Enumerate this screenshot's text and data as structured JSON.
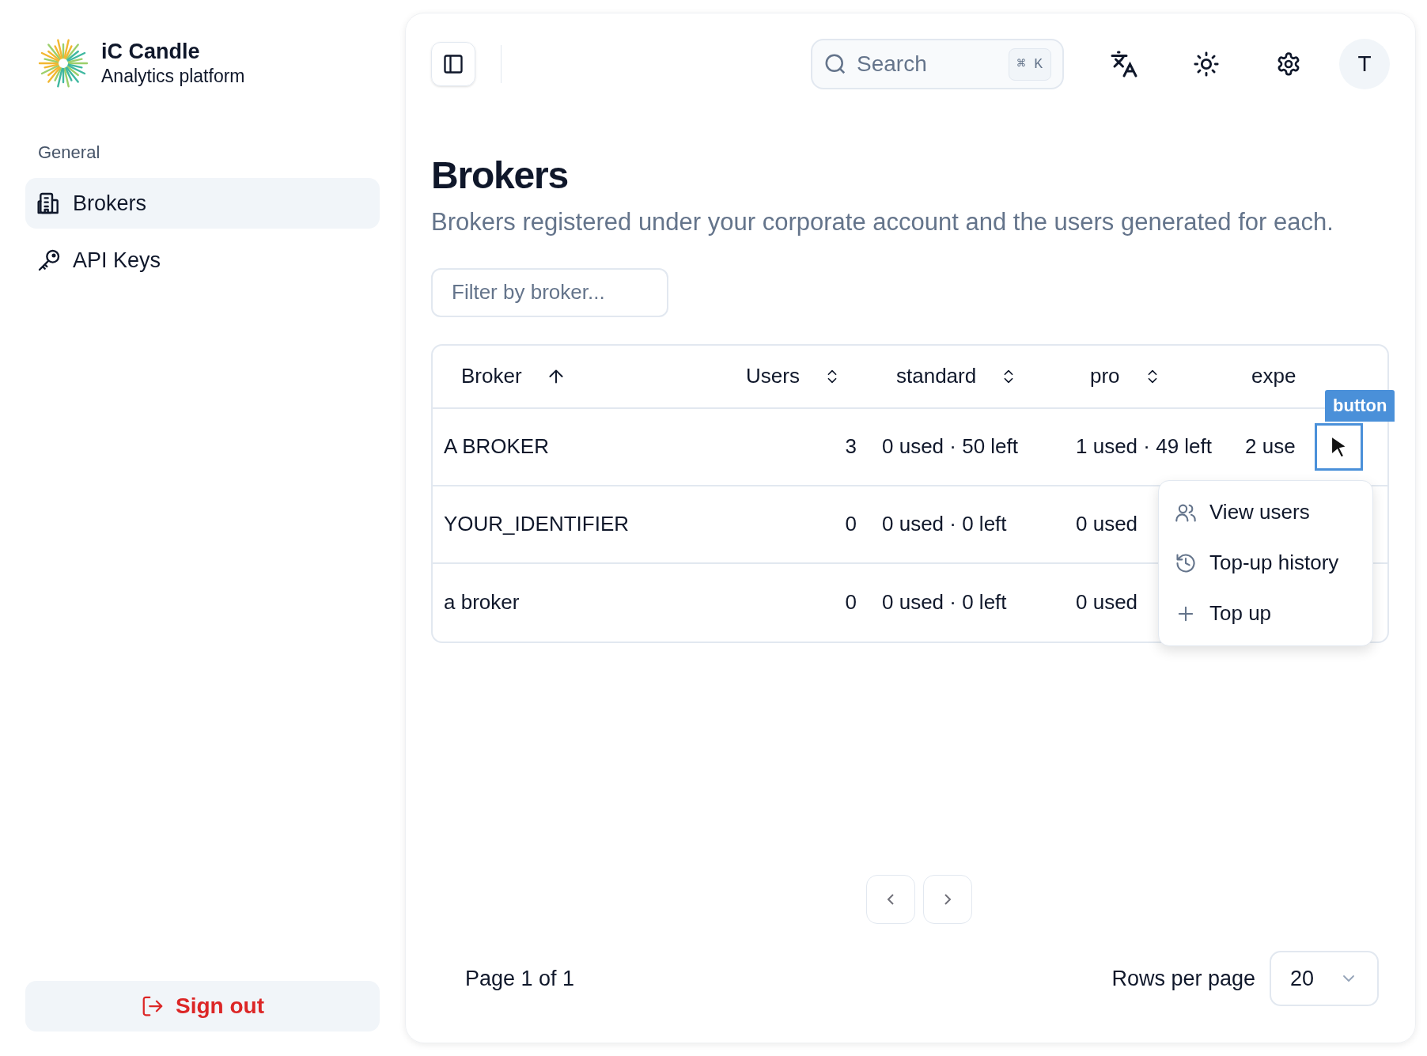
{
  "brand": {
    "name": "iC Candle",
    "tagline": "Analytics platform"
  },
  "sidebar": {
    "section": "General",
    "items": [
      {
        "label": "Brokers",
        "selected": true
      },
      {
        "label": "API Keys",
        "selected": false
      }
    ],
    "sign_out": "Sign out"
  },
  "header": {
    "search": {
      "placeholder": "Search",
      "shortcut": "⌘ K"
    },
    "avatar": "T"
  },
  "page": {
    "title": "Brokers",
    "subtitle": "Brokers registered under your corporate account and the users generated for each.",
    "filter": {
      "placeholder": "Filter by broker..."
    }
  },
  "table": {
    "columns": [
      {
        "label": "Broker",
        "kind": "sorted"
      },
      {
        "label": "Users",
        "kind": "sortable"
      },
      {
        "label": "standard",
        "kind": "sortable"
      },
      {
        "label": "pro",
        "kind": "sortable"
      },
      {
        "label": "expe",
        "kind": "plain"
      }
    ],
    "rows": [
      {
        "cells": [
          "A BROKER",
          "3",
          "0 used · 50 left",
          "1 used · 49 left",
          "2 use"
        ]
      },
      {
        "cells": [
          "YOUR_IDENTIFIER",
          "0",
          "0 used · 0 left",
          "0 used",
          null
        ]
      },
      {
        "cells": [
          "a broker",
          "0",
          "0 used · 0 left",
          "0 used",
          null
        ]
      }
    ]
  },
  "hover_label": "button",
  "row_menu": {
    "items": [
      {
        "label": "View users"
      },
      {
        "label": "Top-up history"
      },
      {
        "label": "Top up"
      }
    ]
  },
  "pagination": {
    "page_info": "Page 1 of 1",
    "rows_per_page_label": "Rows per page",
    "rows_per_page": "20"
  }
}
